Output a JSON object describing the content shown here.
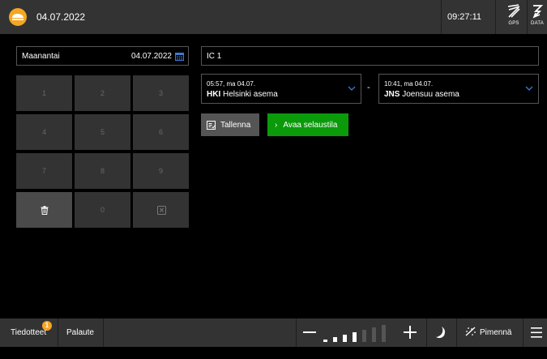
{
  "header": {
    "date": "04.07.2022",
    "time": "09:27:11",
    "gps_label": "GPS",
    "data_label": "DATA",
    "logo_icon": "train-logo-icon"
  },
  "date_picker": {
    "day": "Maanantai",
    "date": "04.07.2022"
  },
  "keypad": {
    "keys": [
      "1",
      "2",
      "3",
      "4",
      "5",
      "6",
      "7",
      "8",
      "9",
      "0"
    ]
  },
  "train": {
    "value": "IC 1"
  },
  "departure": {
    "time": "05:57, ma 04.07.",
    "code": "HKI",
    "name": "Helsinki asema"
  },
  "separator": "-",
  "arrival": {
    "time": "10:41, ma 04.07.",
    "code": "JNS",
    "name": "Joensuu asema"
  },
  "actions": {
    "save_label": "Tallenna",
    "open_label": "Avaa selaustila"
  },
  "footer": {
    "news_label": "Tiedotteet",
    "news_badge": "1",
    "feedback_label": "Palaute",
    "dim_label": "Pimennä",
    "brightness_level": 4,
    "brightness_steps": 7
  },
  "colors": {
    "accent_orange": "#f5a623",
    "action_green": "#0a9a0a",
    "chevron_blue": "#3a7bd5"
  }
}
